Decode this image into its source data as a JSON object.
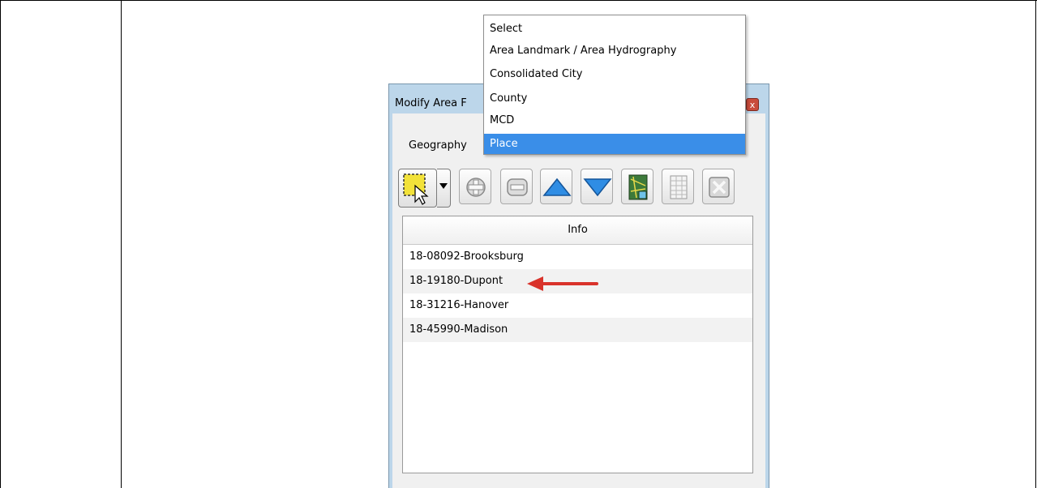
{
  "dialog": {
    "title": "Modify Area F",
    "geography_label": "Geography",
    "close_glyph": "x"
  },
  "dropdown": {
    "options": [
      "Select",
      "Area Landmark / Area Hydrography",
      "Consolidated City",
      "County",
      "MCD",
      "Place"
    ],
    "selected": "Place"
  },
  "toolbar": {
    "icons": [
      "select-rectangle-icon",
      "dropdown-arrow-icon",
      "add-icon",
      "remove-icon",
      "move-up-icon",
      "move-down-icon",
      "map-zoom-icon",
      "table-icon",
      "clear-icon"
    ]
  },
  "list": {
    "header": "Info",
    "rows": [
      "18-08092-Brooksburg",
      "18-19180-Dupont",
      "18-31216-Hanover",
      "18-45990-Madison"
    ]
  },
  "colors": {
    "selection_blue": "#3a8ee8",
    "arrow_red": "#d9332b",
    "dialog_frame": "#bcd6ea"
  }
}
